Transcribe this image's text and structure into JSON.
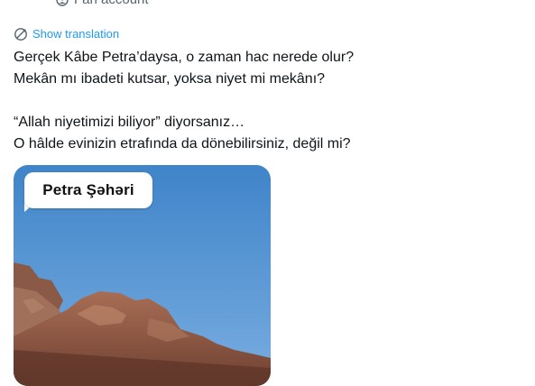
{
  "fan_account": {
    "label": "Fan account",
    "icon": "fan-account-icon"
  },
  "translation": {
    "label": "Show translation",
    "icon": "globe-translate-icon",
    "color": "#1d9bf0"
  },
  "tweet": {
    "lines": [
      "Gerçek Kâbe Petra’daysa, o zaman hac nerede olur?",
      "Mekân mı ibadeti kutsar, yoksa niyet mi mekânı?",
      "",
      "“Allah niyetimizi biliyor” diyorsanız…",
      "O hâlde evinizin etrafında da dönebilirsiniz, değil mi?"
    ]
  },
  "media": {
    "caption": "Petra Şəhəri"
  }
}
